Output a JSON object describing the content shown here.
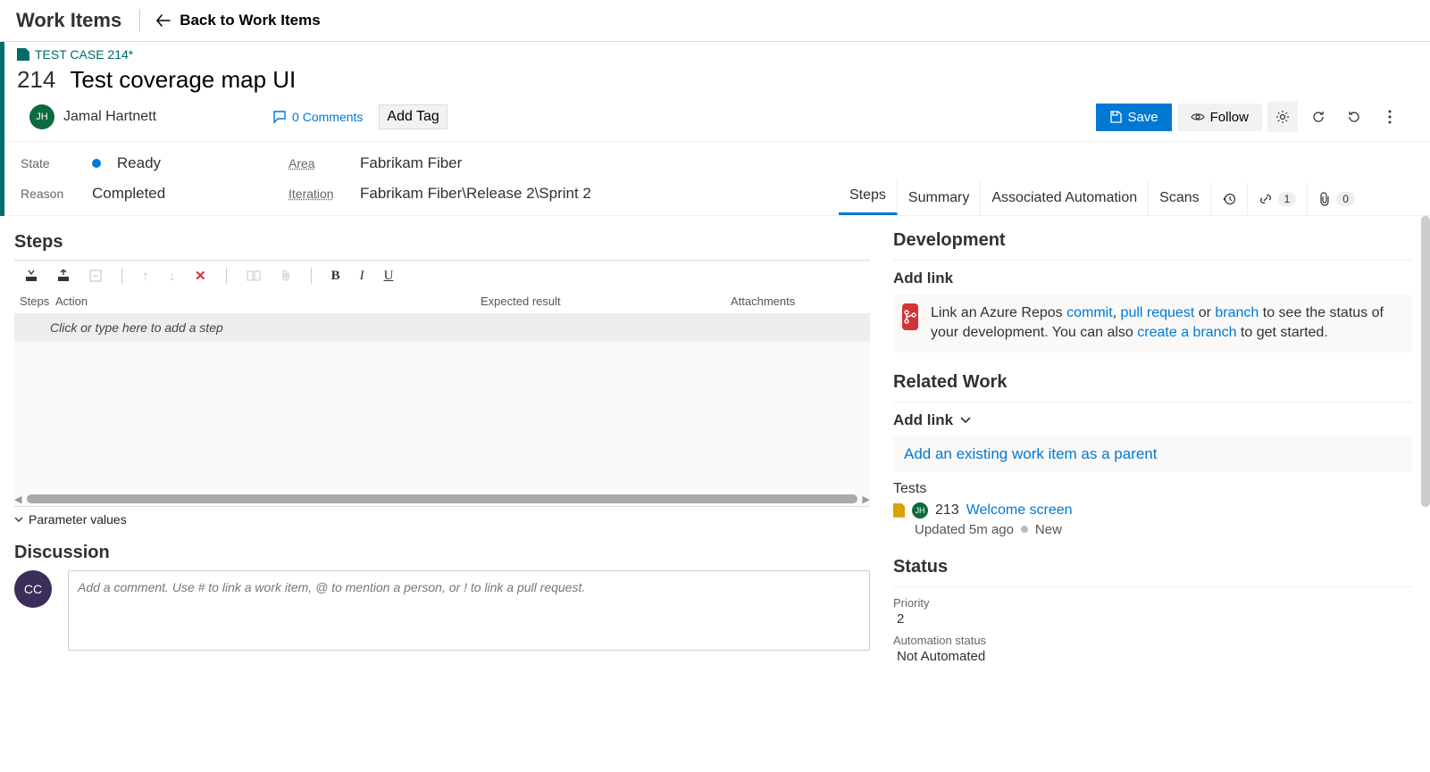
{
  "header": {
    "page_title": "Work Items",
    "back_label": "Back to Work Items"
  },
  "breadcrumb": {
    "label": "TEST CASE 214*"
  },
  "work_item": {
    "id": "214",
    "title": "Test coverage map UI",
    "assignee_initials": "JH",
    "assignee": "Jamal Hartnett",
    "comments_count": "0 Comments",
    "tag_btn": "Add Tag"
  },
  "actions": {
    "save": "Save",
    "follow": "Follow"
  },
  "fields": {
    "state_label": "State",
    "state_value": "Ready",
    "reason_label": "Reason",
    "reason_value": "Completed",
    "area_label": "Area",
    "area_value": "Fabrikam Fiber",
    "iteration_label": "Iteration",
    "iteration_value": "Fabrikam Fiber\\Release 2\\Sprint 2"
  },
  "tabs": {
    "steps": "Steps",
    "summary": "Summary",
    "automation": "Associated Automation",
    "scans": "Scans",
    "links_count": "1",
    "attach_count": "0"
  },
  "steps": {
    "heading": "Steps",
    "col_steps": "Steps",
    "col_action": "Action",
    "col_expected": "Expected result",
    "col_attach": "Attachments",
    "placeholder": "Click or type here to add a step",
    "params": "Parameter values"
  },
  "discussion": {
    "heading": "Discussion",
    "avatar_initials": "CC",
    "placeholder": "Add a comment. Use # to link a work item, @ to mention a person, or ! to link a pull request."
  },
  "side": {
    "development": {
      "title": "Development",
      "add_link": "Add link",
      "text_pre": "Link an Azure Repos ",
      "commit": "commit",
      "sep1": ", ",
      "pull_request": "pull request",
      "or": " or ",
      "branch": "branch",
      "text_mid": " to see the status of your development. You can also ",
      "create_branch": "create a branch",
      "text_post": " to get started."
    },
    "related": {
      "title": "Related Work",
      "add_link": "Add link",
      "parent_link": "Add an existing work item as a parent",
      "tests_label": "Tests",
      "test_id": "213",
      "test_title": "Welcome screen",
      "test_updated": "Updated 5m ago",
      "test_state": "New",
      "av_initials": "JH"
    },
    "status": {
      "title": "Status",
      "priority_label": "Priority",
      "priority_value": "2",
      "automation_label": "Automation status",
      "automation_value": "Not Automated"
    }
  }
}
